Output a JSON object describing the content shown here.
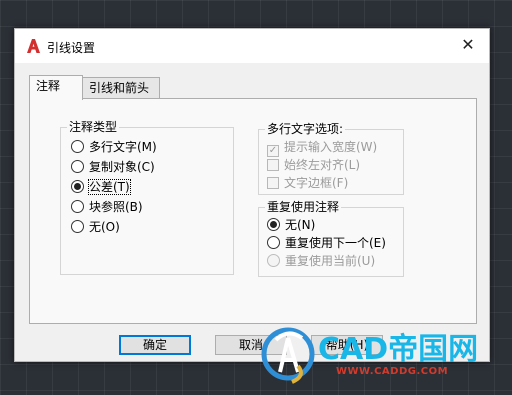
{
  "dialog": {
    "title": "引线设置",
    "close_glyph": "✕"
  },
  "tabs": [
    {
      "label": "注释",
      "active": true
    },
    {
      "label": "引线和箭头",
      "active": false
    }
  ],
  "annotation_type": {
    "legend": "注释类型",
    "options": [
      {
        "label": "多行文字(M)",
        "selected": false
      },
      {
        "label": "复制对象(C)",
        "selected": false
      },
      {
        "label": "公差(T)",
        "selected": true
      },
      {
        "label": "块参照(B)",
        "selected": false
      },
      {
        "label": "无(O)",
        "selected": false
      }
    ]
  },
  "mtext_options": {
    "legend": "多行文字选项:",
    "items": [
      {
        "label": "提示输入宽度(W)",
        "checked": true,
        "enabled": false
      },
      {
        "label": "始终左对齐(L)",
        "checked": false,
        "enabled": false
      },
      {
        "label": "文字边框(F)",
        "checked": false,
        "enabled": false
      }
    ]
  },
  "reuse": {
    "legend": "重复使用注释",
    "options": [
      {
        "label": "无(N)",
        "selected": true,
        "enabled": true
      },
      {
        "label": "重复使用下一个(E)",
        "selected": false,
        "enabled": true
      },
      {
        "label": "重复使用当前(U)",
        "selected": false,
        "enabled": false
      }
    ]
  },
  "buttons": {
    "ok": "确定",
    "cancel": "取消",
    "help": "帮助(H)"
  },
  "watermark": {
    "brand": "CAD帝国网",
    "url": "WWW.CADDG.COM"
  },
  "colors": {
    "focus_blue": "#0078d7",
    "watermark_blue": "#19b6e8",
    "watermark_red": "#d23b2c",
    "app_icon_red": "#d32f2f"
  }
}
